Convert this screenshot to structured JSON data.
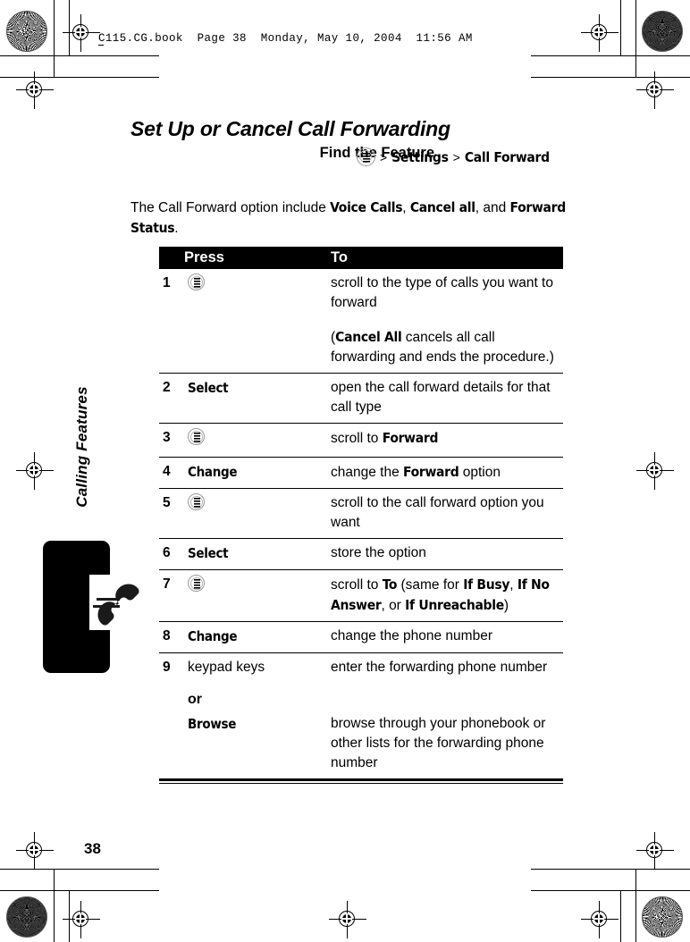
{
  "running_header": {
    "text": "C115.CG.book  Page 38  Monday, May 10, 2004  11:56 AM"
  },
  "chapter": {
    "label": "Calling Features",
    "icon": "telephone-handset-icon"
  },
  "page": {
    "title": "Set Up or Cancel Call Forwarding",
    "number": "38"
  },
  "find_feature": {
    "label": "Find the Feature",
    "icon": "menu-key-icon",
    "separator": ">",
    "path": [
      "Settings",
      "Call Forward"
    ]
  },
  "intro": {
    "before": "The Call Forward option include ",
    "term1": "Voice Calls",
    "mid1": ", ",
    "term2": "Cancel all",
    "mid2": ", and ",
    "term3": "Forward Status",
    "after": "."
  },
  "table": {
    "headers": {
      "num": "",
      "press": "Press",
      "to": "To"
    },
    "rows": [
      {
        "num": "1",
        "press_icon": "menu-key-icon",
        "press_label": "",
        "to": "scroll to the type of calls you want to forward",
        "to_extra_prefix": "(",
        "to_extra_term": "Cancel All",
        "to_extra_suffix": " cancels all call forwarding and ends the procedure.)"
      },
      {
        "num": "2",
        "press_icon": "",
        "press_label": "Select",
        "to": "open the call forward details for that call type"
      },
      {
        "num": "3",
        "press_icon": "menu-key-icon",
        "press_label": "",
        "to_prefix": "scroll to ",
        "to_term": "Forward",
        "to_suffix": ""
      },
      {
        "num": "4",
        "press_icon": "",
        "press_label": "Change",
        "to_prefix": "change the ",
        "to_term": "Forward",
        "to_suffix": " option"
      },
      {
        "num": "5",
        "press_icon": "menu-key-icon",
        "press_label": "",
        "to": "scroll to the call forward option you want"
      },
      {
        "num": "6",
        "press_icon": "",
        "press_label": "Select",
        "to": "store the option"
      },
      {
        "num": "7",
        "press_icon": "menu-key-icon",
        "press_label": "",
        "to_prefix": "scroll to ",
        "to_term": "To",
        "to_mid1": " (same for ",
        "to_term2": "If Busy",
        "to_mid2": ", ",
        "to_term3": "If No Answer",
        "to_mid3": ", or ",
        "to_term4": "If Unreachable",
        "to_suffix": ")"
      },
      {
        "num": "8",
        "press_icon": "",
        "press_label": "Change",
        "to": "change the phone number"
      },
      {
        "num": "9",
        "press_icon": "",
        "press_label": "keypad keys",
        "press_plain": true,
        "to": "enter the forwarding phone number"
      }
    ],
    "or_label": "or",
    "browse_row": {
      "press_label": "Browse",
      "to": "browse through your phonebook or other lists for the forwarding phone number"
    }
  }
}
